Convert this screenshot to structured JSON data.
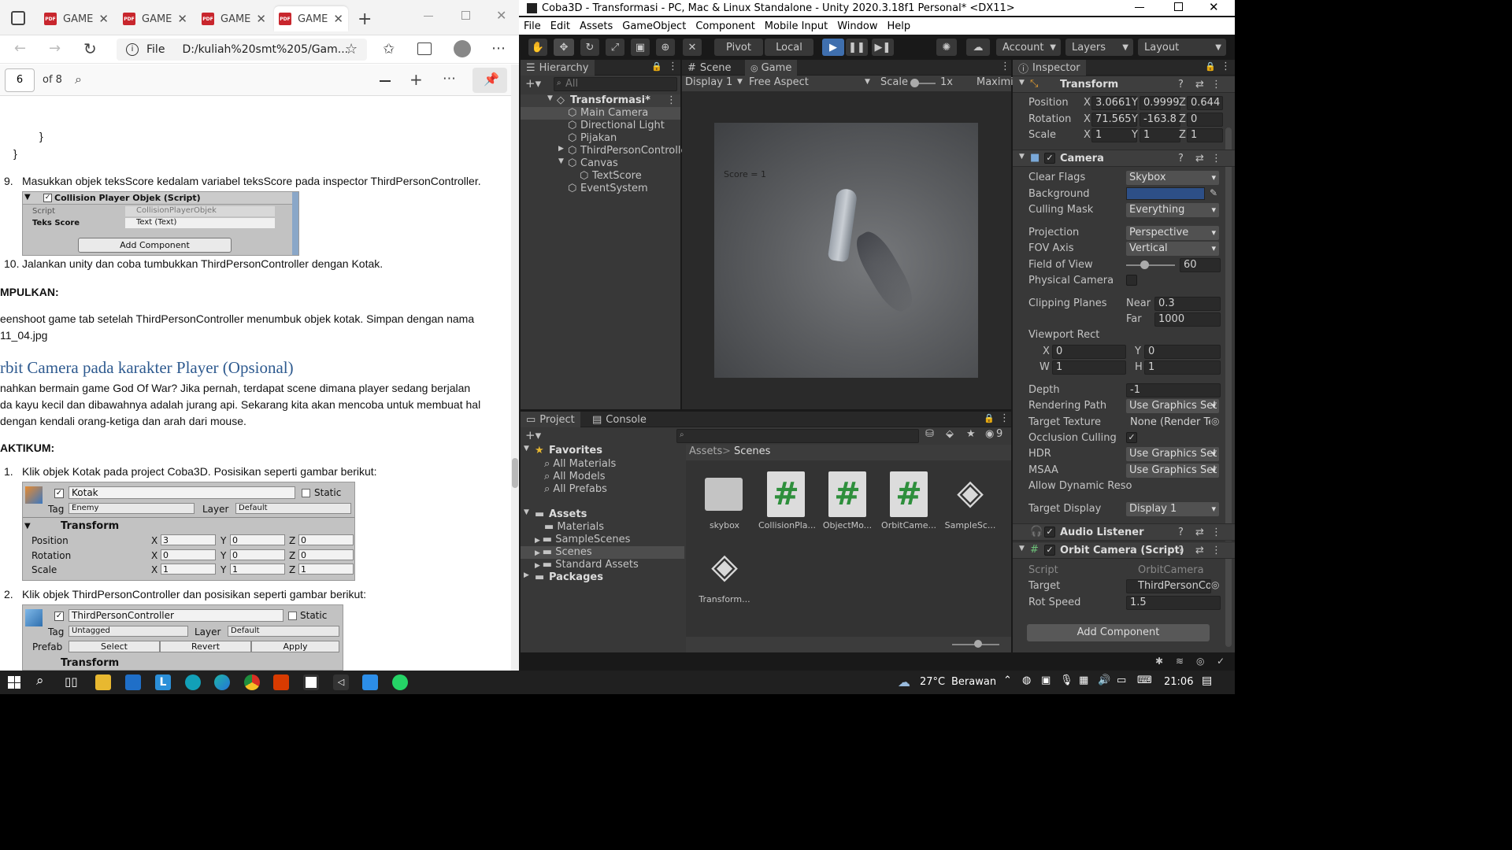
{
  "edge": {
    "tabs": [
      {
        "label": "GAME"
      },
      {
        "label": "GAME"
      },
      {
        "label": "GAME"
      },
      {
        "label": "GAME"
      }
    ],
    "tab_close": "✕",
    "file_label": "File",
    "url": "D:/kuliah%20smt%205/Gam...",
    "pdf": {
      "page_current": "6",
      "page_total": "of 8"
    },
    "page_text": {
      "brace1": "}",
      "brace2": "}",
      "step9_num": "9.",
      "step9": "Masukkan objek teksScore kedalam variabel teksScore pada inspector ThirdPersonController.",
      "insp1_title": "Collision Player Objek (Script)",
      "insp1_script_label": "Script",
      "insp1_script_value": "CollisionPlayerObjek",
      "insp1_teks_label": "Teks Score",
      "insp1_teks_value": "Text (Text)",
      "insp1_add": "Add Component",
      "step10_num": "10.",
      "step10": "Jalankan unity dan coba tumbukkan ThirdPersonController dengan Kotak.",
      "kesimpulan": "MPULKAN:",
      "ss_line1": "eenshoot game tab setelah ThirdPersonController menumbuk objek kotak. Simpan dengan nama",
      "ss_line2": "11_04.jpg",
      "heading": "rbit Camera pada karakter Player (Opsional)",
      "para1": "nahkan bermain game God Of War? Jika pernah, terdapat scene dimana player sedang berjalan",
      "para2": "da kayu kecil dan dibawahnya adalah jurang api. Sekarang kita akan mencoba untuk membuat hal",
      "para3": "dengan kendali orang-ketiga dan arah dari mouse.",
      "praktikum": "AKTIKUM:",
      "p1_num": "1.",
      "p1": "Klik objek Kotak pada project Coba3D. Posisikan seperti gambar berikut:",
      "kotak_name": "Kotak",
      "static": "Static",
      "tag_label": "Tag",
      "kotak_tag": "Enemy",
      "layer_label": "Layer",
      "layer_value": "Default",
      "transform": "Transform",
      "position": "Position",
      "rotation": "Rotation",
      "scale": "Scale",
      "kotak_pos": [
        "3",
        "0",
        "0"
      ],
      "kotak_rot": [
        "0",
        "0",
        "0"
      ],
      "kotak_scale": [
        "1",
        "1",
        "1"
      ],
      "p2_num": "2.",
      "p2": "Klik objek ThirdPersonController dan posisikan seperti gambar berikut:",
      "tpc_name": "ThirdPersonController",
      "tpc_tag": "Untagged",
      "prefab": "Prefab",
      "select": "Select",
      "revert": "Revert",
      "apply": "Apply",
      "transform2": "Transform"
    }
  },
  "unity": {
    "title": "Coba3D - Transformasi - PC, Mac & Linux Standalone - Unity 2020.3.18f1 Personal* <DX11>",
    "menu": [
      "File",
      "Edit",
      "Assets",
      "GameObject",
      "Component",
      "Mobile Input",
      "Window",
      "Help"
    ],
    "toolbar": {
      "pivot": "Pivot",
      "local": "Local",
      "account": "Account",
      "layers": "Layers",
      "layout": "Layout"
    },
    "hierarchy": {
      "tab": "Hierarchy",
      "search_placeholder": "All",
      "scene": "Transformasi*",
      "items": [
        "Main Camera",
        "Directional Light",
        "Pijakan",
        "ThirdPersonControlle",
        "Canvas",
        "TextScore",
        "EventSystem"
      ]
    },
    "scene_tab": "Scene",
    "game_tab": "Game",
    "game": {
      "display": "Display 1",
      "aspect": "Free Aspect",
      "scale_label": "Scale",
      "scale_value": "1x",
      "maximize": "Maximi",
      "score_text": "Score = 1"
    },
    "project": {
      "tab": "Project",
      "console_tab": "Console",
      "hidden_count": "9",
      "favorites": "Favorites",
      "fav_items": [
        "All Materials",
        "All Models",
        "All Prefabs"
      ],
      "assets": "Assets",
      "asset_items": [
        "Materials",
        "SampleScenes",
        "Scenes",
        "Standard Assets"
      ],
      "packages": "Packages",
      "breadcrumb": [
        "Assets",
        "Scenes"
      ],
      "files": [
        {
          "name": "skybox",
          "icon": "folder-icon"
        },
        {
          "name": "CollisionPla...",
          "icon": "script-icon"
        },
        {
          "name": "ObjectMo...",
          "icon": "script-icon"
        },
        {
          "name": "OrbitCame...",
          "icon": "script-icon"
        },
        {
          "name": "SampleSc...",
          "icon": "unity-scene-icon"
        },
        {
          "name": "Transform...",
          "icon": "unity-scene-icon"
        }
      ]
    },
    "inspector": {
      "tab": "Inspector",
      "transform": {
        "title": "Transform",
        "position_label": "Position",
        "position": [
          "3.0661",
          "0.9999",
          "0.644"
        ],
        "rotation_label": "Rotation",
        "rotation": [
          "71.565",
          "-163.8",
          "0"
        ],
        "scale_label": "Scale",
        "scale": [
          "1",
          "1",
          "1"
        ]
      },
      "camera": {
        "title": "Camera",
        "clear_flags_label": "Clear Flags",
        "clear_flags": "Skybox",
        "background_label": "Background",
        "background_color": "#2d4f87",
        "culling_mask_label": "Culling Mask",
        "culling_mask": "Everything",
        "projection_label": "Projection",
        "projection": "Perspective",
        "fov_axis_label": "FOV Axis",
        "fov_axis": "Vertical",
        "fov_label": "Field of View",
        "fov": "60",
        "physical_label": "Physical Camera",
        "clipping_label": "Clipping Planes",
        "near_label": "Near",
        "near": "0.3",
        "far_label": "Far",
        "far": "1000",
        "viewport_label": "Viewport Rect",
        "vx_label": "X",
        "vx": "0",
        "vy_label": "Y",
        "vy": "0",
        "vw_label": "W",
        "vw": "1",
        "vh_label": "H",
        "vh": "1",
        "depth_label": "Depth",
        "depth": "-1",
        "rendering_path_label": "Rendering Path",
        "rendering_path": "Use Graphics Set",
        "target_texture_label": "Target Texture",
        "target_texture": "None (Render Te",
        "occlusion_label": "Occlusion Culling",
        "hdr_label": "HDR",
        "hdr": "Use Graphics Set",
        "msaa_label": "MSAA",
        "msaa": "Use Graphics Set",
        "dynamic_label": "Allow Dynamic Reso",
        "target_display_label": "Target Display",
        "target_display": "Display 1"
      },
      "audio_listener": "Audio Listener",
      "orbit": {
        "title": "Orbit Camera (Script)",
        "script_label": "Script",
        "script": "OrbitCamera",
        "target_label": "Target",
        "target": "ThirdPersonCo",
        "rot_speed_label": "Rot Speed",
        "rot_speed": "1.5"
      },
      "add_component": "Add Component"
    }
  },
  "taskbar": {
    "temperature": "27°C",
    "weather": "Berawan",
    "time": "21:06"
  }
}
